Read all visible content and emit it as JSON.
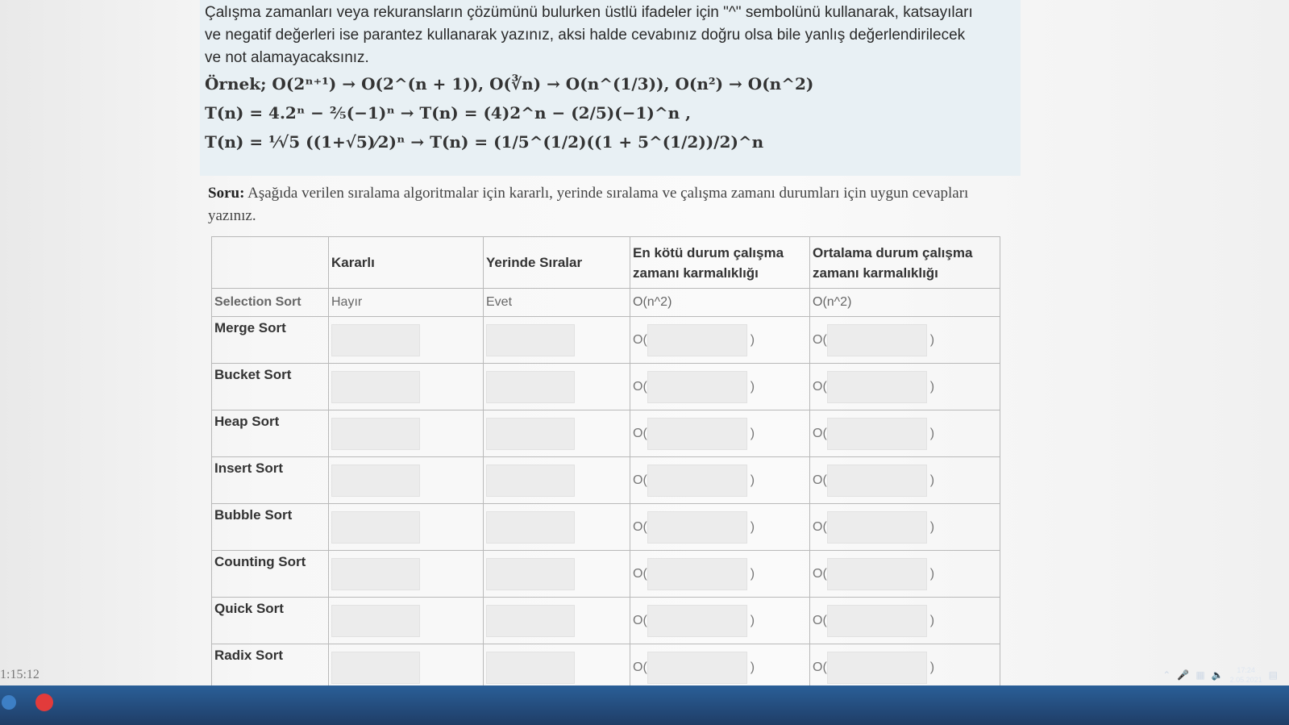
{
  "instructions": {
    "line1": "Çalışma zamanları veya rekuransların çözümünü bulurken üstlü ifadeler için \"^\" sembolünü kullanarak, katsayıları",
    "line2": "ve negatif değerleri ise parantez kullanarak yazınız, aksi halde cevabınız doğru olsa bile yanlış değerlendirilecek",
    "line3": "ve not alamayacaksınız.",
    "example1": "Örnek; O(2ⁿ⁺¹) → O(2^(n + 1)),  O(∛n) → O(n^(1/3)), O(n²) → O(n^2)",
    "example2": "T(n) = 4.2ⁿ − ²⁄₅(−1)ⁿ → T(n) = (4)2^n − (2/5)(−1)^n ,",
    "example3": "T(n) = ¹⁄√5 ((1+√5)⁄2)ⁿ → T(n) = (1/5^(1/2)((1 + 5^(1/2))/2)^n"
  },
  "question": {
    "label": "Soru:",
    "text": " Aşağıda verilen sıralama algoritmalar için kararlı, yerinde sıralama ve çalışma zamanı durumları için uygun cevapları yazınız."
  },
  "table": {
    "headers": [
      "",
      "Kararlı",
      "Yerinde Sıralar",
      "En kötü durum çalışma zamanı karmalıklığı",
      "Ortalama durum çalışma zamanı karmalıklığı"
    ],
    "example_row": {
      "name": "Selection Sort",
      "stable": "Hayır",
      "inplace": "Evet",
      "worst": "O(n^2)",
      "average": "O(n^2)"
    },
    "o_prefix": "O(",
    "o_suffix": ")",
    "rows": [
      {
        "name": "Merge Sort"
      },
      {
        "name": "Bucket Sort"
      },
      {
        "name": "Heap Sort"
      },
      {
        "name": "Insert Sort"
      },
      {
        "name": "Bubble Sort"
      },
      {
        "name": "Counting Sort"
      },
      {
        "name": "Quick Sort"
      },
      {
        "name": "Radix Sort"
      }
    ]
  },
  "footer": {
    "clock": "1:15:12",
    "tray_time": "17:24",
    "tray_date": "2.05.2021"
  }
}
